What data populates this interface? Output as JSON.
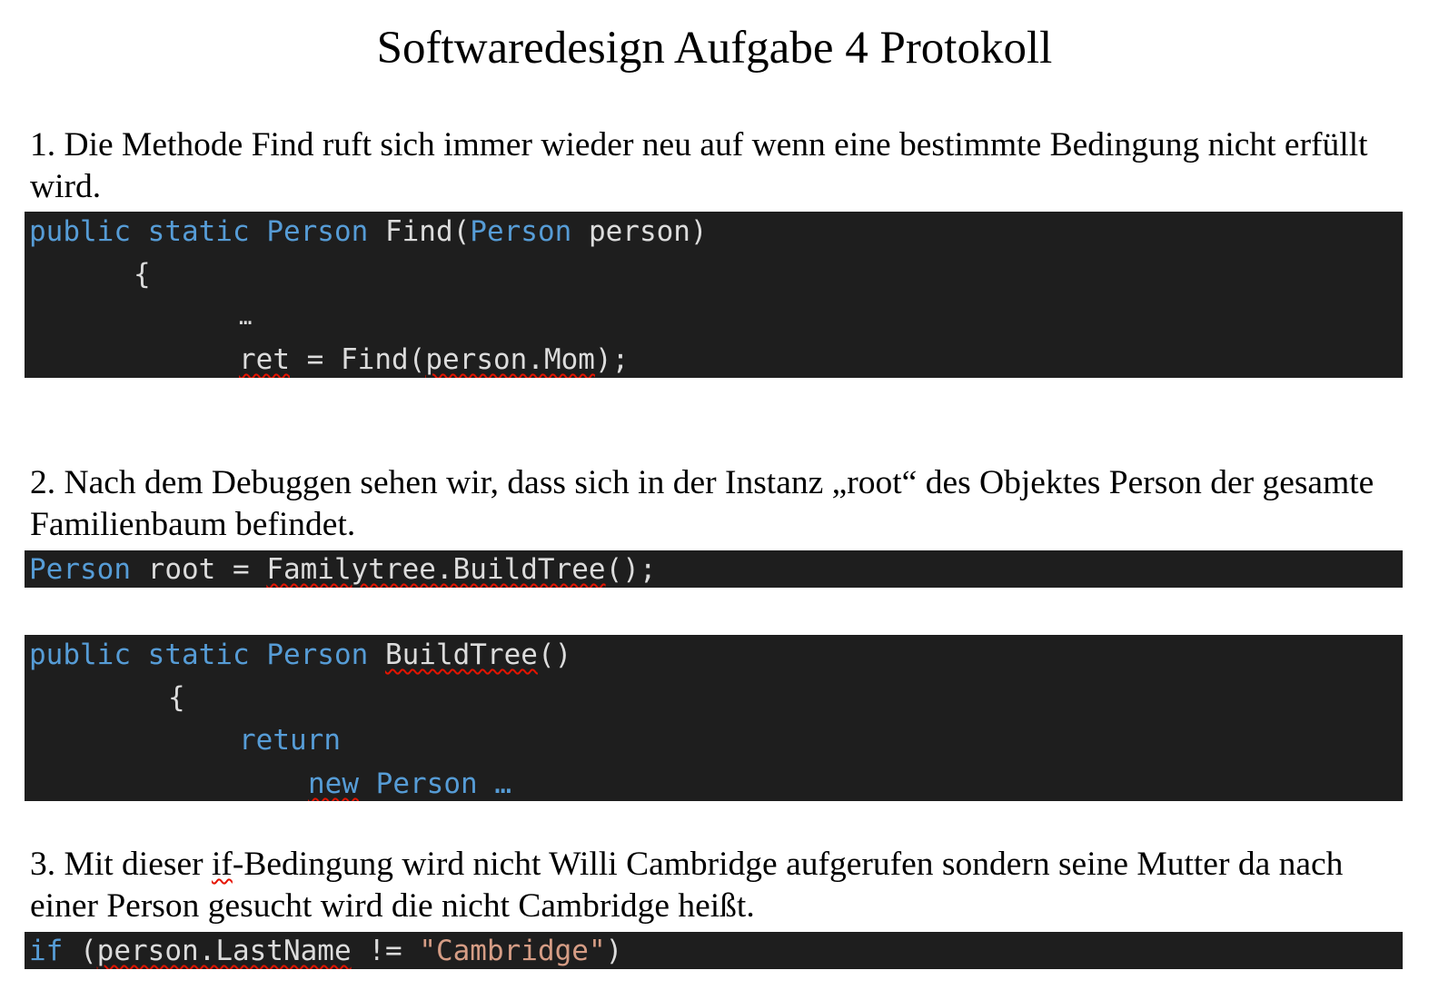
{
  "title": "Softwaredesign Aufgabe 4 Protokoll",
  "section1": {
    "text": "1. Die Methode Find ruft sich immer wieder neu auf wenn eine bestimmte Bedingung nicht erfüllt wird.",
    "code": {
      "l1_kw1": "public",
      "l1_kw2": "static",
      "l1_type": "Person",
      "l1_method": "Find(",
      "l1_ptype": "Person",
      "l1_rest": "person)",
      "l2": "{",
      "l3": "…",
      "l4_var": "ret",
      "l4_mid": "= Find(",
      "l4_arg": "person.Mom",
      "l4_end": ");"
    }
  },
  "section2": {
    "text": "2. Nach dem Debuggen sehen wir, dass sich in der Instanz „root“ des Objektes Person der gesamte Familienbaum befindet.",
    "code1": {
      "type": "Person",
      "mid": "root =",
      "call": "Familytree.BuildTree",
      "end": "();"
    },
    "code2": {
      "l1_kw1": "public",
      "l1_kw2": "static",
      "l1_type": "Person",
      "l1_method": "BuildTree",
      "l1_end": "()",
      "l2": "{",
      "l3": "return",
      "l4_new": "new",
      "l4_type": "Person",
      "l4_rest": "…"
    }
  },
  "section3": {
    "text_a": "3. Mit dieser ",
    "text_if": "if",
    "text_b": "-Bedingung wird nicht Willi Cambridge aufgerufen sondern seine Mutter da nach einer Person gesucht wird die nicht Cambridge heißt.",
    "code": {
      "kw": "if",
      "open": "(",
      "member": "person.LastName",
      "op": "!=",
      "str": "\"Cambridge\"",
      "close": ")"
    }
  }
}
